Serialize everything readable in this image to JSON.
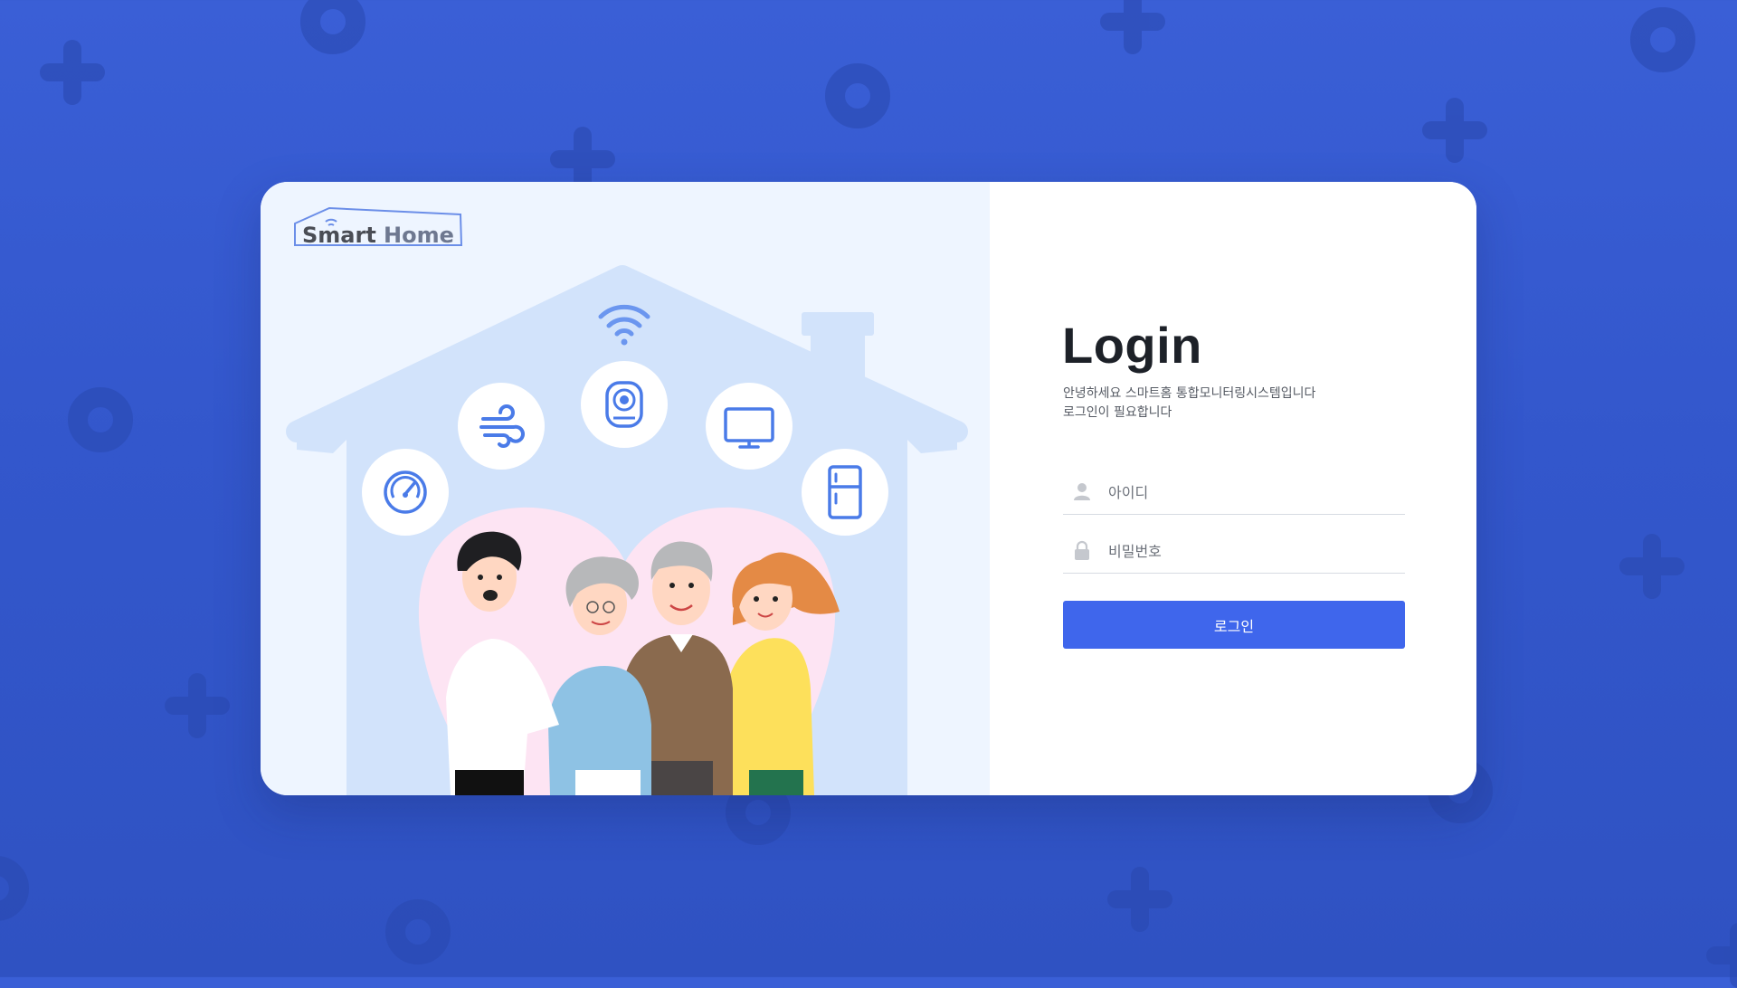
{
  "brand": {
    "logo_text_1": "Smart",
    "logo_text_2": "Home"
  },
  "login": {
    "title": "Login",
    "subtitle_line1": "안녕하세요 스마트홈 통합모니터링시스템입니다",
    "subtitle_line2": "로그인이 필요합니다",
    "id_placeholder": "아이디",
    "password_placeholder": "비밀번호",
    "submit_label": "로그인"
  },
  "colors": {
    "background": "#3357cc",
    "card_left": "#eef5ff",
    "house": "#d2e3fb",
    "heart": "#fde4f3",
    "icon_blue": "#4a7be8",
    "button": "#3f66ec",
    "title": "#1d2128"
  },
  "illustration": {
    "icons": [
      "gauge-icon",
      "wind-icon",
      "camera-icon",
      "monitor-icon",
      "refrigerator-icon",
      "wifi-icon"
    ],
    "people": [
      "man",
      "grandmother",
      "grandfather",
      "woman"
    ]
  }
}
